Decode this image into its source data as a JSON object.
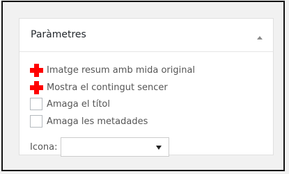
{
  "panel": {
    "title": "Paràmetres",
    "toggle_icon": "triangle-up-icon"
  },
  "options": [
    {
      "label": "Imatge resum amb mida original",
      "checked": true
    },
    {
      "label": "Mostra el contingut sencer",
      "checked": true
    },
    {
      "label": "Amaga el títol",
      "checked": false
    },
    {
      "label": "Amaga les metadades",
      "checked": false
    }
  ],
  "icon_select": {
    "label": "Icona:",
    "value": "",
    "arrow_icon": "caret-down-icon"
  },
  "colors": {
    "marker": "#ff0000",
    "frame": "#111111"
  }
}
